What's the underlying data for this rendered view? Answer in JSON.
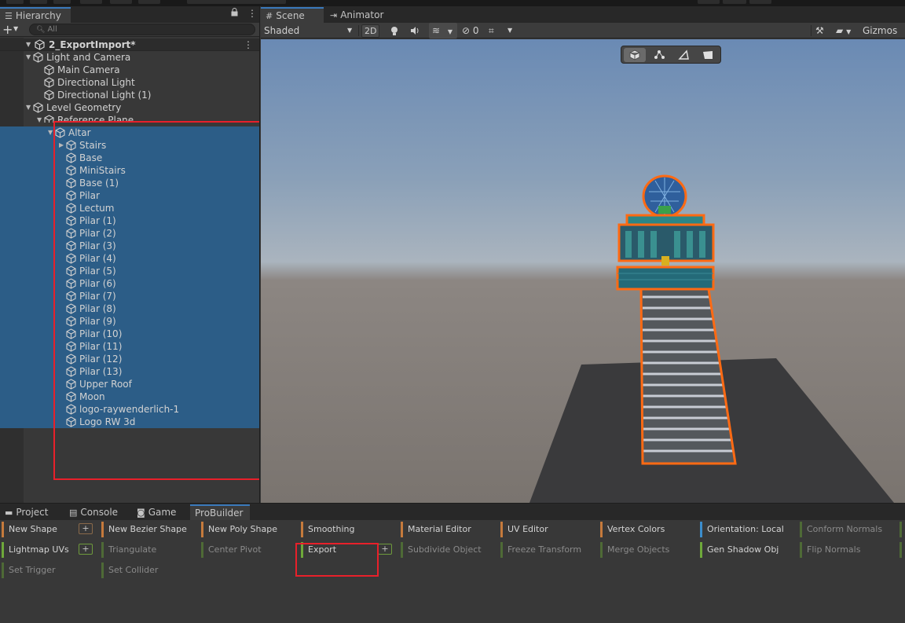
{
  "hierarchy": {
    "tab_label": "Hierarchy",
    "search_placeholder": "All",
    "scene_name": "2_ExportImport*",
    "items": [
      {
        "label": "Light and Camera"
      },
      {
        "label": "Main Camera"
      },
      {
        "label": "Directional Light"
      },
      {
        "label": "Directional Light (1)"
      },
      {
        "label": "Level Geometry"
      },
      {
        "label": "Reference Plane"
      },
      {
        "label": "Altar"
      },
      {
        "label": "Stairs"
      },
      {
        "label": "Base"
      },
      {
        "label": "MiniStairs"
      },
      {
        "label": "Base (1)"
      },
      {
        "label": "Pilar"
      },
      {
        "label": "Lectum"
      },
      {
        "label": "Pilar (1)"
      },
      {
        "label": "Pilar (2)"
      },
      {
        "label": "Pilar (3)"
      },
      {
        "label": "Pilar (4)"
      },
      {
        "label": "Pilar (5)"
      },
      {
        "label": "Pilar (6)"
      },
      {
        "label": "Pilar (7)"
      },
      {
        "label": "Pilar (8)"
      },
      {
        "label": "Pilar (9)"
      },
      {
        "label": "Pilar (10)"
      },
      {
        "label": "Pilar (11)"
      },
      {
        "label": "Pilar (12)"
      },
      {
        "label": "Pilar (13)"
      },
      {
        "label": "Upper Roof"
      },
      {
        "label": "Moon"
      },
      {
        "label": "logo-raywenderlich-1"
      },
      {
        "label": "Logo RW 3d"
      }
    ]
  },
  "scene": {
    "tabs": [
      {
        "label": "Scene"
      },
      {
        "label": "Animator"
      }
    ],
    "shading_mode": "Shaded",
    "mode_2d": "2D",
    "hidden_count": "0",
    "gizmos_label": "Gizmos"
  },
  "bottom": {
    "tabs": [
      {
        "label": "Project"
      },
      {
        "label": "Console"
      },
      {
        "label": "Game"
      },
      {
        "label": "ProBuilder"
      }
    ],
    "probuilder": {
      "row1": [
        "New Shape",
        "New Bezier Shape",
        "New Poly Shape",
        "Smoothing",
        "Material Editor",
        "UV Editor",
        "Vertex Colors",
        "Orientation: Local",
        "Conform Normals"
      ],
      "row2": [
        "Lightmap UVs",
        "Triangulate",
        "Center Pivot",
        "Export",
        "Subdivide Object",
        "Freeze Transform",
        "Merge Objects",
        "Gen Shadow Obj",
        "Flip Normals"
      ],
      "row3": [
        "Set Trigger",
        "Set Collider"
      ],
      "plus_label": "+"
    }
  },
  "colors": {
    "selection": "#2c5d87",
    "highlight_box": "#e8202a",
    "sky_top": "#6a8ab4",
    "ground": "#7a746f",
    "object_outline": "#ff6a13"
  }
}
